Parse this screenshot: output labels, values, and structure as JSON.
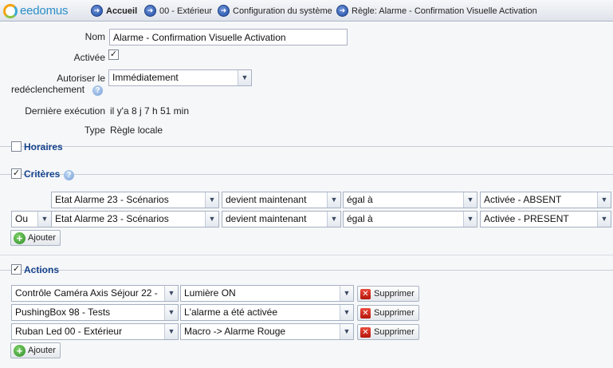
{
  "topbar": {
    "logo": "eedomus",
    "breadcrumbs": [
      {
        "label": "Accueil"
      },
      {
        "label": "00 - Extérieur"
      },
      {
        "label": "Configuration du système"
      },
      {
        "label": "Règle: Alarme - Confirmation Visuelle Activation"
      }
    ]
  },
  "form": {
    "name_label": "Nom",
    "name_value": "Alarme - Confirmation Visuelle Activation",
    "active_label": "Activée",
    "active_checked": "✓",
    "retrigger_label_line1": "Autoriser le",
    "retrigger_label_line2": "redéclenchement",
    "retrigger_value": "Immédiatement",
    "last_exec_label": "Dernière exécution",
    "last_exec_value": "il y'a 8 j 7 h 51 min",
    "type_label": "Type",
    "type_value": "Règle locale",
    "help_glyph": "?"
  },
  "sections": {
    "horaires": {
      "title": "Horaires",
      "checked": ""
    },
    "criteres": {
      "title": "Critères",
      "checked": "✓"
    },
    "actions": {
      "title": "Actions",
      "checked": "✓"
    }
  },
  "criteria": [
    {
      "operator": "",
      "device": "Etat Alarme 23 - Scénarios",
      "condition": "devient maintenant",
      "comparison": "égal à",
      "value": "Activée - ABSENT"
    },
    {
      "operator": "Ou",
      "device": "Etat Alarme 23 - Scénarios",
      "condition": "devient maintenant",
      "comparison": "égal à",
      "value": "Activée - PRESENT"
    }
  ],
  "actions": [
    {
      "device": "Contrôle Caméra Axis Séjour 22 -",
      "action": "Lumière ON"
    },
    {
      "device": "PushingBox 98 - Tests",
      "action": "L'alarme a été activée"
    },
    {
      "device": "Ruban Led 00 - Extérieur",
      "action": "Macro -> Alarme Rouge"
    }
  ],
  "buttons": {
    "add_label": "Ajouter",
    "delete_label": "Supprimer",
    "plus_glyph": "+",
    "delete_glyph": "✕",
    "arrow_glyph": "➜",
    "chevron_glyph": "▼"
  },
  "colors": {
    "accent": "#15428b",
    "brand": "#2b8fc7",
    "add": "#2e8b26",
    "delete": "#c9251a"
  }
}
